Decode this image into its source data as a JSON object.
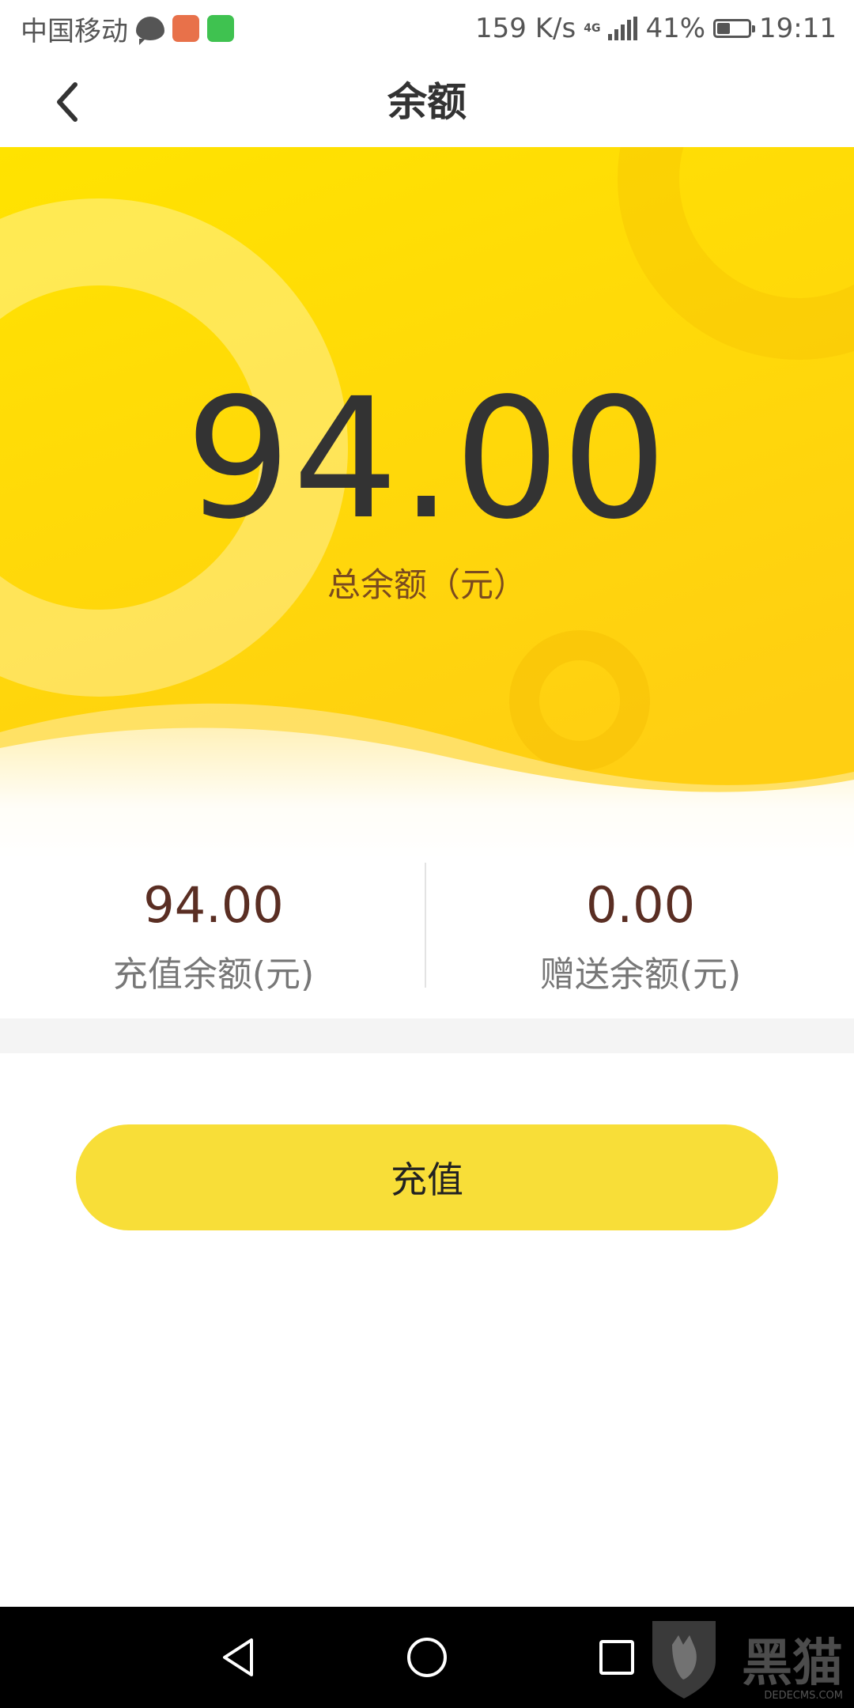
{
  "status_bar": {
    "carrier": "中国移动",
    "net_speed": "159 K/s",
    "network_type": "4G",
    "battery_percent_text": "41%",
    "battery_level": 0.41,
    "time": "19:11",
    "icons": [
      "chat-icon",
      "app-icon-orange",
      "app-icon-green",
      "signal-icon",
      "battery-icon"
    ]
  },
  "header": {
    "title": "余额",
    "back_icon": "chevron-left-icon"
  },
  "hero": {
    "total_amount": "94.00",
    "total_caption": "总余额（元）",
    "colors": {
      "top": "#ffe100",
      "bottom": "#ffd21a",
      "ring": "#ffffff"
    }
  },
  "sub_balances": {
    "recharge": {
      "value": "94.00",
      "label": "充值余额(元)"
    },
    "gift": {
      "value": "0.00",
      "label": "赠送余额(元)"
    }
  },
  "actions": {
    "recharge_label": "充值",
    "accent_color": "#f8de38"
  },
  "nav_bar": {
    "icons": [
      "back-triangle-icon",
      "home-circle-icon",
      "recent-square-icon"
    ]
  },
  "watermark": {
    "text": "黑猫",
    "sub": "DEDECMS.COM"
  }
}
